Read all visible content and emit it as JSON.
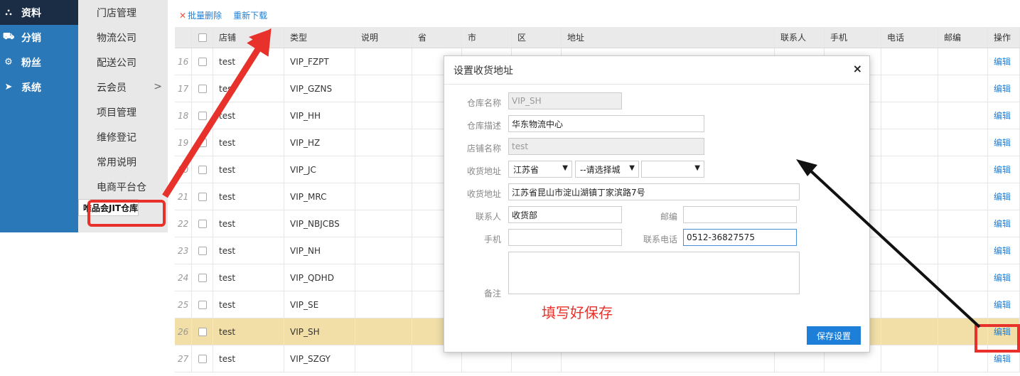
{
  "nav": {
    "items": [
      {
        "label": "资料",
        "icon": "sitemap-icon",
        "glyph": "⛬"
      },
      {
        "label": "分销",
        "icon": "truck-icon",
        "glyph": "⛟"
      },
      {
        "label": "粉丝",
        "icon": "gear-icon",
        "glyph": "⚙"
      },
      {
        "label": "系统",
        "icon": "location-arrow-icon",
        "glyph": "➤"
      }
    ],
    "sub_items": [
      "门店管理",
      "物流公司",
      "配送公司",
      "云会员",
      "项目管理",
      "维修登记",
      "常用说明",
      "电商平台仓",
      "唯品会JIT仓库"
    ],
    "sub_chevron": ">"
  },
  "toolbar": {
    "batch_delete": "批量删除",
    "redownload": "重新下载",
    "x_glyph": "✕"
  },
  "table": {
    "headers": [
      "店铺",
      "类型",
      "说明",
      "省",
      "市",
      "区",
      "地址",
      "联系人",
      "手机",
      "电话",
      "邮编",
      "操作"
    ],
    "rows": [
      {
        "num": "16",
        "shop": "test",
        "type": "VIP_FZPT",
        "op": "编辑"
      },
      {
        "num": "17",
        "shop": "test",
        "type": "VIP_GZNS",
        "op": "编辑"
      },
      {
        "num": "18",
        "shop": "test",
        "type": "VIP_HH",
        "op": "编辑"
      },
      {
        "num": "19",
        "shop": "test",
        "type": "VIP_HZ",
        "op": "编辑"
      },
      {
        "num": "20",
        "shop": "test",
        "type": "VIP_JC",
        "op": "编辑"
      },
      {
        "num": "21",
        "shop": "test",
        "type": "VIP_MRC",
        "op": "编辑"
      },
      {
        "num": "22",
        "shop": "test",
        "type": "VIP_NBJCBS",
        "op": "编辑"
      },
      {
        "num": "23",
        "shop": "test",
        "type": "VIP_NH",
        "op": "编辑"
      },
      {
        "num": "24",
        "shop": "test",
        "type": "VIP_QDHD",
        "op": "编辑"
      },
      {
        "num": "25",
        "shop": "test",
        "type": "VIP_SE",
        "op": "编辑"
      },
      {
        "num": "26",
        "shop": "test",
        "type": "VIP_SH",
        "op": "编辑"
      },
      {
        "num": "27",
        "shop": "test",
        "type": "VIP_SZGY",
        "op": "编辑"
      }
    ]
  },
  "modal": {
    "title": "设置收货地址",
    "close": "×",
    "warehouse_name_label": "仓库名称",
    "warehouse_name": "VIP_SH",
    "warehouse_desc_label": "仓库描述",
    "warehouse_desc": "华东物流中心",
    "shop_name_label": "店铺名称",
    "shop_name": "test",
    "region_label": "收货地址",
    "province": "江苏省",
    "city": "--请选择城",
    "district": "",
    "address_label": "收货地址",
    "address": "江苏省昆山市淀山湖镇丁家滨路7号",
    "contact_label": "联系人",
    "contact": "收货部",
    "zip_label": "邮编",
    "zip": "",
    "mobile_label": "手机",
    "mobile": "",
    "tel_label": "联系电话",
    "tel": "0512-36827575",
    "remark_label": "备注",
    "remark": "",
    "save": "保存设置",
    "dropdown_glyph": "▼"
  },
  "annotation": {
    "hint": "填写好保存",
    "color": "#e8312a"
  }
}
